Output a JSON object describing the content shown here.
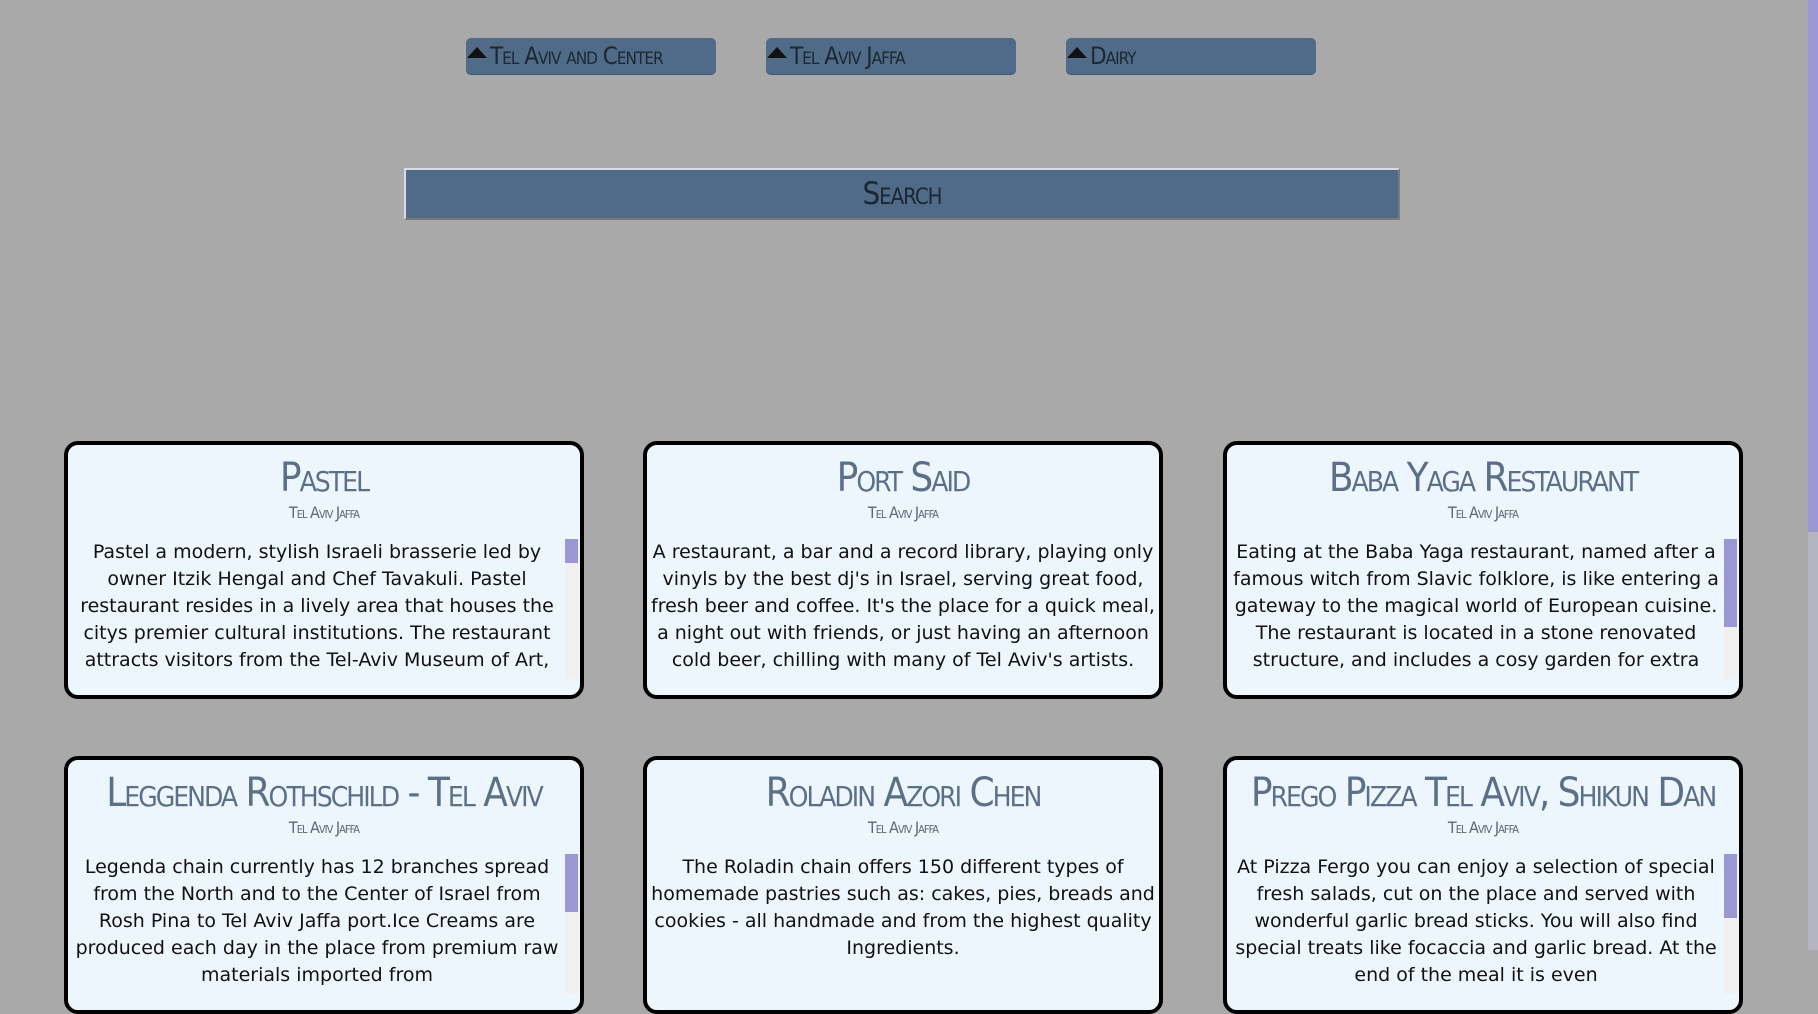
{
  "filters": [
    {
      "label": "Tel Aviv and Center"
    },
    {
      "label": "Tel Aviv Jaffa"
    },
    {
      "label": "Dairy"
    }
  ],
  "search": {
    "label": "Search"
  },
  "cards": [
    {
      "name": "Pastel",
      "area": "Tel Aviv Jaffa",
      "description": "Pastel a modern, stylish Israeli brasserie led by owner Itzik Hengal and Chef Tavakuli. Pastel restaurant resides in a lively area that houses the citys premier cultural institutions. The restaurant attracts visitors from the Tel-Aviv Museum of Art, the Cameri Theatre, and the Israeli"
    },
    {
      "name": "Port Said",
      "area": "Tel Aviv Jaffa",
      "description": "A restaurant, a bar and a record library, playing only vinyls by the best dj's in Israel, serving great food, fresh beer and coffee. It's the place for a quick meal, a night out with friends, or just having an afternoon cold beer, chilling with many of Tel Aviv's artists."
    },
    {
      "name": "Baba Yaga Restaurant",
      "area": "Tel Aviv Jaffa",
      "description": "Eating at the Baba Yaga restaurant, named after a famous witch from Slavic folklore, is like entering a gateway to the magical world of European cuisine. The restaurant is located in a stone renovated structure, and includes a cosy garden for extra atmosphere. The"
    },
    {
      "name": "Leggenda Rothschild - Tel Aviv",
      "area": "Tel Aviv Jaffa",
      "description": "Legenda chain currently has 12 branches spread from the North and to the Center of Israel from Rosh Pina to Tel Aviv Jaffa port.Ice Creams are produced each day in the place from premium raw materials imported from"
    },
    {
      "name": "Roladin Azori Chen",
      "area": "Tel Aviv Jaffa",
      "description": "The Roladin chain offers 150 different types of homemade pastries such as: cakes, pies, breads and cookies - all handmade and from the highest quality Ingredients."
    },
    {
      "name": "Prego Pizza Tel Aviv, Shikun Dan",
      "area": "Tel Aviv Jaffa",
      "description": "At Pizza Fergo you can enjoy a selection of special fresh salads, cut on the place and served with wonderful garlic bread sticks. You will also find special treats like focaccia and garlic bread. At the end of the meal it is even"
    }
  ]
}
